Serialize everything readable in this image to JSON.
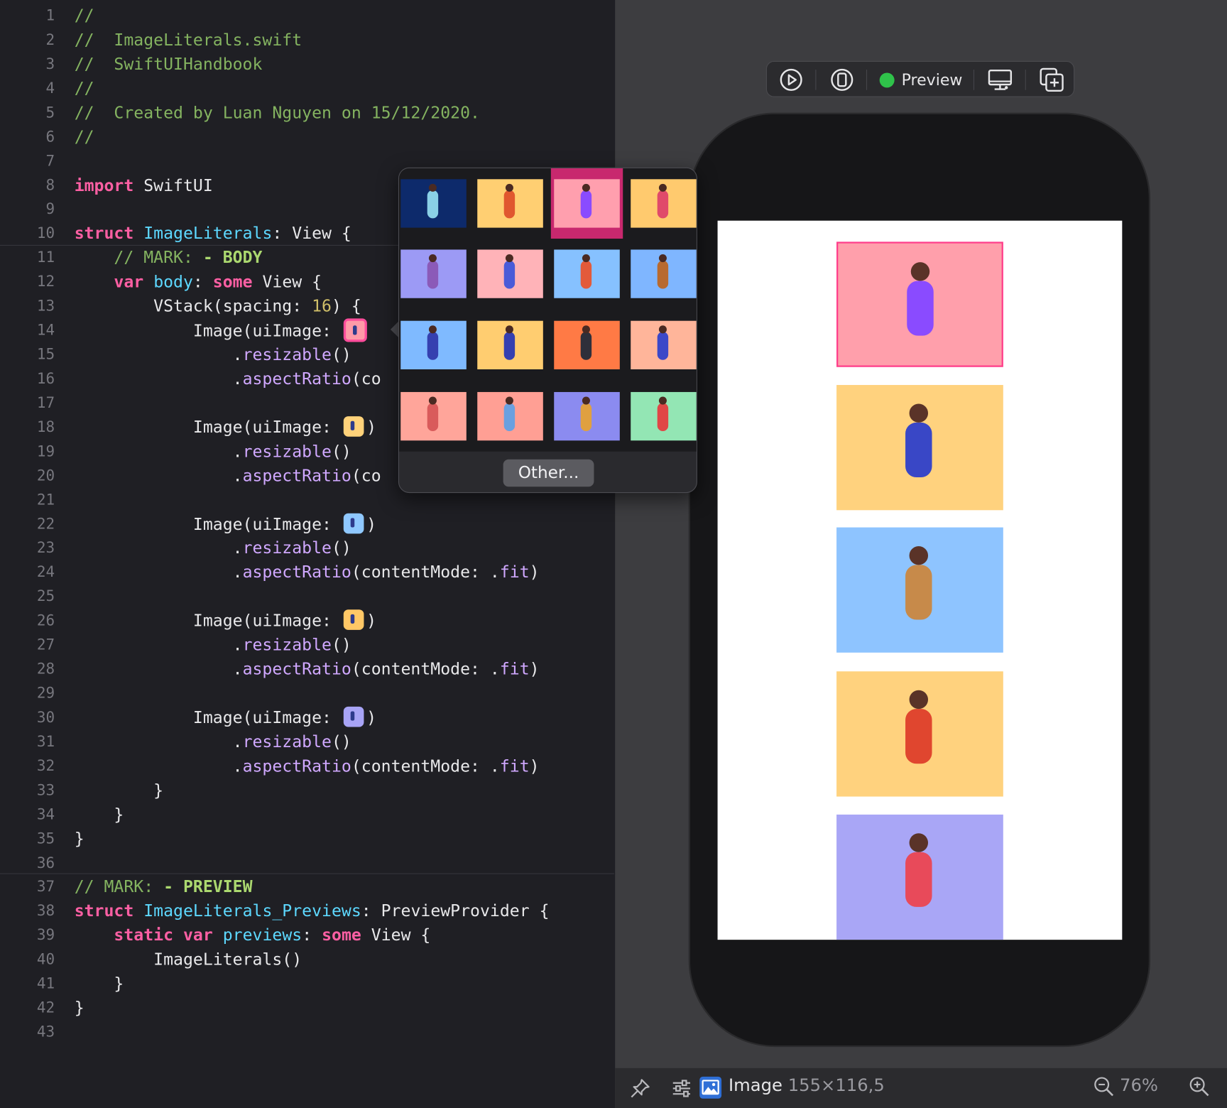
{
  "editor": {
    "lines": [
      {
        "n": "1",
        "segs": [
          {
            "t": "//",
            "c": "c"
          }
        ]
      },
      {
        "n": "2",
        "segs": [
          {
            "t": "//  ImageLiterals.swift",
            "c": "c"
          }
        ]
      },
      {
        "n": "3",
        "segs": [
          {
            "t": "//  SwiftUIHandbook",
            "c": "c"
          }
        ]
      },
      {
        "n": "4",
        "segs": [
          {
            "t": "//",
            "c": "c"
          }
        ]
      },
      {
        "n": "5",
        "segs": [
          {
            "t": "//  Created by Luan Nguyen on 15/12/2020.",
            "c": "c"
          }
        ]
      },
      {
        "n": "6",
        "segs": [
          {
            "t": "//",
            "c": "c"
          }
        ]
      },
      {
        "n": "7",
        "segs": []
      },
      {
        "n": "8",
        "segs": [
          {
            "t": "import",
            "c": "k"
          },
          {
            "t": " SwiftUI",
            "c": ""
          }
        ]
      },
      {
        "n": "9",
        "segs": []
      },
      {
        "n": "10",
        "segs": [
          {
            "t": "struct",
            "c": "k"
          },
          {
            "t": " "
          },
          {
            "t": "ImageLiterals",
            "c": "t"
          },
          {
            "t": ": View {"
          }
        ]
      },
      {
        "n": "11",
        "segs": [
          {
            "t": "    // MARK: ",
            "c": "c"
          },
          {
            "t": "- BODY",
            "c": "cb"
          }
        ]
      },
      {
        "n": "12",
        "segs": [
          {
            "t": "    "
          },
          {
            "t": "var",
            "c": "k"
          },
          {
            "t": " "
          },
          {
            "t": "body",
            "c": "t"
          },
          {
            "t": ": "
          },
          {
            "t": "some",
            "c": "k"
          },
          {
            "t": " View {"
          }
        ]
      },
      {
        "n": "13",
        "segs": [
          {
            "t": "        VStack(spacing: "
          },
          {
            "t": "16",
            "c": "n"
          },
          {
            "t": ") {"
          }
        ]
      },
      {
        "n": "14",
        "segs": [
          {
            "t": "            Image(uiImage: "
          },
          {
            "lit": "#ff9aa8",
            "sel": true
          }
        ]
      },
      {
        "n": "15",
        "segs": [
          {
            "t": "                ."
          },
          {
            "t": "resizable",
            "c": "m"
          },
          {
            "t": "()"
          }
        ]
      },
      {
        "n": "16",
        "segs": [
          {
            "t": "                ."
          },
          {
            "t": "aspectRatio",
            "c": "m"
          },
          {
            "t": "(co"
          }
        ]
      },
      {
        "n": "17",
        "segs": []
      },
      {
        "n": "18",
        "segs": [
          {
            "t": "            Image(uiImage: "
          },
          {
            "lit": "#ffd27a"
          },
          {
            "t": ")"
          }
        ]
      },
      {
        "n": "19",
        "segs": [
          {
            "t": "                ."
          },
          {
            "t": "resizable",
            "c": "m"
          },
          {
            "t": "()"
          }
        ]
      },
      {
        "n": "20",
        "segs": [
          {
            "t": "                ."
          },
          {
            "t": "aspectRatio",
            "c": "m"
          },
          {
            "t": "(co"
          }
        ]
      },
      {
        "n": "21",
        "segs": []
      },
      {
        "n": "22",
        "segs": [
          {
            "t": "            Image(uiImage: "
          },
          {
            "lit": "#8fc8ff"
          },
          {
            "t": ")"
          }
        ]
      },
      {
        "n": "23",
        "segs": [
          {
            "t": "                ."
          },
          {
            "t": "resizable",
            "c": "m"
          },
          {
            "t": "()"
          }
        ]
      },
      {
        "n": "24",
        "segs": [
          {
            "t": "                ."
          },
          {
            "t": "aspectRatio",
            "c": "m"
          },
          {
            "t": "(contentMode: ."
          },
          {
            "t": "fit",
            "c": "m"
          },
          {
            "t": ")"
          }
        ]
      },
      {
        "n": "25",
        "segs": []
      },
      {
        "n": "26",
        "segs": [
          {
            "t": "            Image(uiImage: "
          },
          {
            "lit": "#ffc766"
          },
          {
            "t": ")"
          }
        ]
      },
      {
        "n": "27",
        "segs": [
          {
            "t": "                ."
          },
          {
            "t": "resizable",
            "c": "m"
          },
          {
            "t": "()"
          }
        ]
      },
      {
        "n": "28",
        "segs": [
          {
            "t": "                ."
          },
          {
            "t": "aspectRatio",
            "c": "m"
          },
          {
            "t": "(contentMode: ."
          },
          {
            "t": "fit",
            "c": "m"
          },
          {
            "t": ")"
          }
        ]
      },
      {
        "n": "29",
        "segs": []
      },
      {
        "n": "30",
        "segs": [
          {
            "t": "            Image(uiImage: "
          },
          {
            "lit": "#a8a4f6"
          },
          {
            "t": ")"
          }
        ]
      },
      {
        "n": "31",
        "segs": [
          {
            "t": "                ."
          },
          {
            "t": "resizable",
            "c": "m"
          },
          {
            "t": "()"
          }
        ]
      },
      {
        "n": "32",
        "segs": [
          {
            "t": "                ."
          },
          {
            "t": "aspectRatio",
            "c": "m"
          },
          {
            "t": "(contentMode: ."
          },
          {
            "t": "fit",
            "c": "m"
          },
          {
            "t": ")"
          }
        ]
      },
      {
        "n": "33",
        "segs": [
          {
            "t": "        }"
          }
        ]
      },
      {
        "n": "34",
        "segs": [
          {
            "t": "    }"
          }
        ]
      },
      {
        "n": "35",
        "segs": [
          {
            "t": "}"
          }
        ]
      },
      {
        "n": "36",
        "segs": []
      },
      {
        "n": "37",
        "segs": [
          {
            "t": "// MARK: ",
            "c": "c"
          },
          {
            "t": "- PREVIEW",
            "c": "cb"
          }
        ]
      },
      {
        "n": "38",
        "segs": [
          {
            "t": "struct",
            "c": "k"
          },
          {
            "t": " "
          },
          {
            "t": "ImageLiterals_Previews",
            "c": "t"
          },
          {
            "t": ": PreviewProvider {"
          }
        ]
      },
      {
        "n": "39",
        "segs": [
          {
            "t": "    "
          },
          {
            "t": "static",
            "c": "k"
          },
          {
            "t": " "
          },
          {
            "t": "var",
            "c": "k"
          },
          {
            "t": " "
          },
          {
            "t": "previews",
            "c": "t"
          },
          {
            "t": ": "
          },
          {
            "t": "some",
            "c": "k"
          },
          {
            "t": " View {"
          }
        ]
      },
      {
        "n": "40",
        "segs": [
          {
            "t": "        ImageLiterals()"
          }
        ]
      },
      {
        "n": "41",
        "segs": [
          {
            "t": "    }"
          }
        ]
      },
      {
        "n": "42",
        "segs": [
          {
            "t": "}"
          }
        ]
      },
      {
        "n": "43",
        "segs": []
      }
    ]
  },
  "toolbar": {
    "live_icon": "play-circle-icon",
    "device_icon": "device-icon",
    "preview_label": "Preview",
    "settings_icon": "monitor-icon",
    "duplicate_icon": "duplicate-plus-icon"
  },
  "picker": {
    "other_label": "Other...",
    "selected_index": 2,
    "tiles": [
      {
        "bg": "#0d2a6b",
        "fig": "#8ad0e6"
      },
      {
        "bg": "#ffcf72",
        "fig": "#e0572f"
      },
      {
        "bg": "#ff9fae",
        "fig": "#8a4bff"
      },
      {
        "bg": "#ffca6e",
        "fig": "#e04a6a"
      },
      {
        "bg": "#9c9af5",
        "fig": "#8b5ab8"
      },
      {
        "bg": "#ffb3b8",
        "fig": "#4a5bd8"
      },
      {
        "bg": "#86c1ff",
        "fig": "#e35a3a"
      },
      {
        "bg": "#7fb6ff",
        "fig": "#b86a2f"
      },
      {
        "bg": "#7fbaff",
        "fig": "#3540b0"
      },
      {
        "bg": "#ffcd70",
        "fig": "#3540b0"
      },
      {
        "bg": "#ff7a45",
        "fig": "#2f2f3a"
      },
      {
        "bg": "#ffb59a",
        "fig": "#3b48c8"
      },
      {
        "bg": "#ffa59a",
        "fig": "#d95b5b"
      },
      {
        "bg": "#ff9f94",
        "fig": "#6aa0e0"
      },
      {
        "bg": "#8b8bf0",
        "fig": "#e0a040"
      },
      {
        "bg": "#93e6b4",
        "fig": "#e04646"
      }
    ]
  },
  "preview_images": [
    {
      "bg": "#ff9fab",
      "fig": "#8a4bff"
    },
    {
      "bg": "#ffd27e",
      "fig": "#3947c6"
    },
    {
      "bg": "#8ec4ff",
      "fig": "#c78a4a"
    },
    {
      "bg": "#ffd27e",
      "fig": "#e0462f"
    },
    {
      "bg": "#a9a6f6",
      "fig": "#e84a5a"
    }
  ],
  "status": {
    "pin_icon": "pin-icon",
    "inspector_icon": "sliders-icon",
    "image_icon": "image-icon",
    "element_label": "Image",
    "element_size": "155×116,5",
    "zoom_out_icon": "zoom-out-icon",
    "zoom_level": "76%",
    "zoom_in_icon": "zoom-in-icon",
    "colors": {
      "blue": "#2f6fd6",
      "text": "#e6e6e8",
      "dim": "#9a9aa0"
    }
  }
}
